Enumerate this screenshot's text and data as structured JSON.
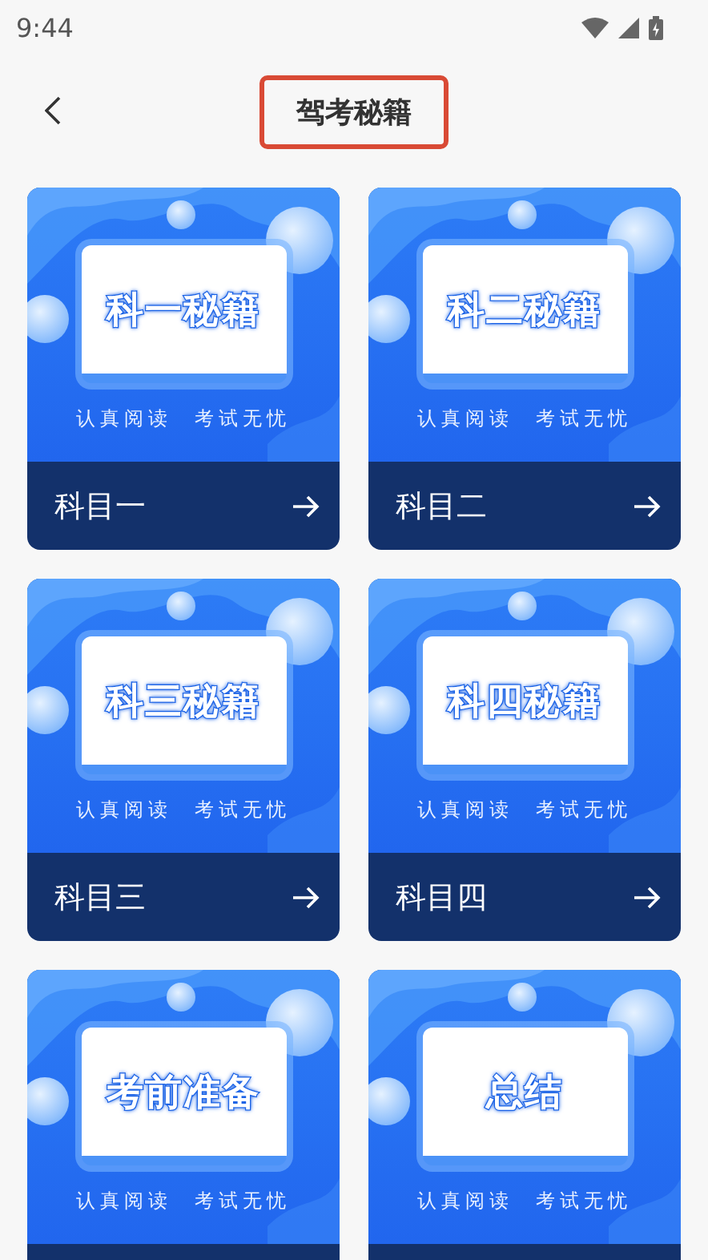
{
  "status_bar": {
    "time": "9:44"
  },
  "header": {
    "title": "驾考秘籍",
    "highlighted": true
  },
  "cards": [
    {
      "title": "科一秘籍",
      "tagline": "认真阅读  考试无忧",
      "label": "科目一"
    },
    {
      "title": "科二秘籍",
      "tagline": "认真阅读  考试无忧",
      "label": "科目二"
    },
    {
      "title": "科三秘籍",
      "tagline": "认真阅读  考试无忧",
      "label": "科目三"
    },
    {
      "title": "科四秘籍",
      "tagline": "认真阅读  考试无忧",
      "label": "科目四"
    },
    {
      "title": "考前准备",
      "tagline": "认真阅读  考试无忧"
    },
    {
      "title": "总结",
      "tagline": "认真阅读  考试无忧"
    }
  ]
}
